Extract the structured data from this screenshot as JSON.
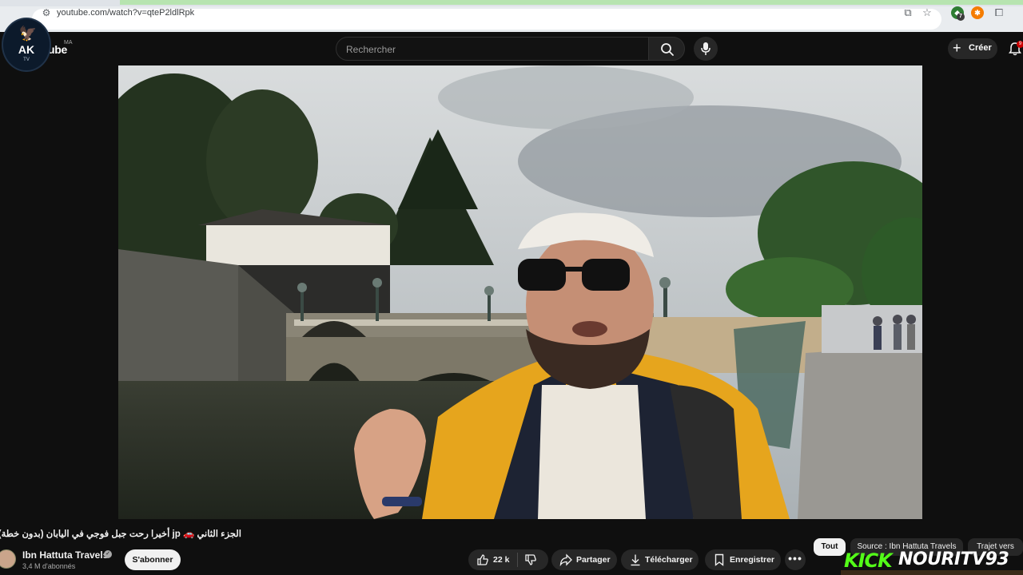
{
  "browser": {
    "url": "youtube.com/watch?v=qteP2ldlRpk",
    "extension_badge": "7"
  },
  "header": {
    "logo_text": "ube",
    "region": "MA",
    "search_placeholder": "Rechercher",
    "create_label": "Créer",
    "notification_count": "9"
  },
  "channel_logo": {
    "initials": "AK",
    "tag": "TV"
  },
  "video": {
    "title": "الجزء الثاني 🚗 jp أخيرا رحت جبل فوجي في اليابان (بدون خطة)"
  },
  "owner": {
    "name": "Ibn Hattuta Travels",
    "subscribers": "3,4 M d'abonnés",
    "subscribe_label": "S'abonner"
  },
  "actions": {
    "like_count": "22 k",
    "share_label": "Partager",
    "download_label": "Télécharger",
    "save_label": "Enregistrer",
    "more_label": "•••"
  },
  "chips": [
    {
      "label": "Tout",
      "active": true
    },
    {
      "label": "Source : Ibn Hattuta Travels",
      "active": false
    },
    {
      "label": "Trajet vers",
      "active": false
    }
  ],
  "overlay": {
    "kick": "KICK",
    "streamer": "NOURITV93"
  },
  "colors": {
    "background": "#0f0f0f",
    "kick_green": "#53fc18",
    "pill": "#272727"
  }
}
